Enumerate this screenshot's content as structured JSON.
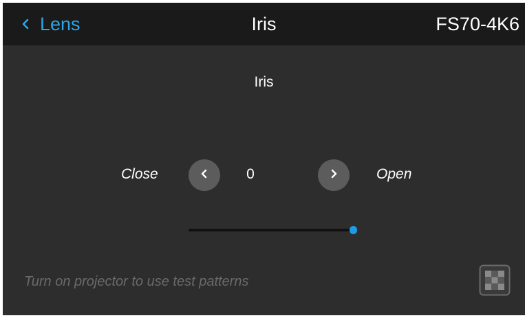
{
  "header": {
    "back_label": "Lens",
    "title": "Iris",
    "model": "FS70-4K6"
  },
  "iris": {
    "section_title": "Iris",
    "close_label": "Close",
    "open_label": "Open",
    "value": "0",
    "slider_fraction": 1.0
  },
  "footer": {
    "hint": "Turn on projector to use test patterns",
    "pattern_icon": "test-pattern-icon"
  },
  "colors": {
    "accent": "#2aa6e8",
    "background": "#2d2d2d",
    "header_background": "#1a1a1a",
    "button": "#5c5c5c",
    "slider_thumb": "#1e9be6",
    "hint_text": "#6a6a6a"
  }
}
